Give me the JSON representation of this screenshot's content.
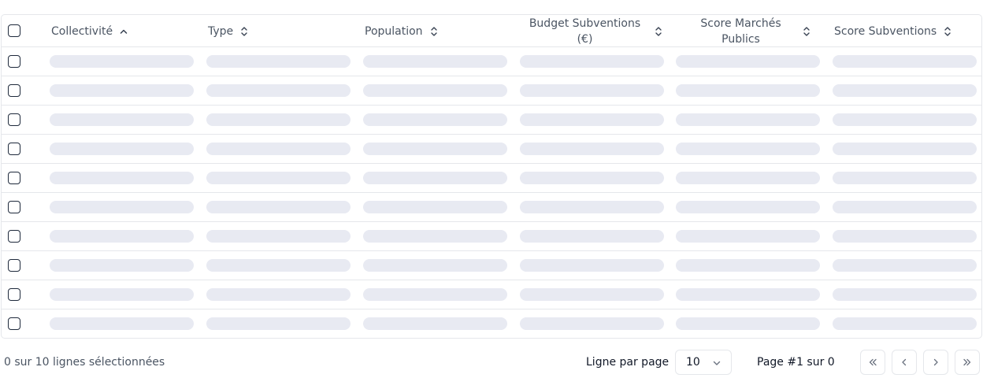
{
  "table": {
    "columns": [
      {
        "label": "Collectivité",
        "sort": "asc"
      },
      {
        "label": "Type",
        "sort": "none"
      },
      {
        "label": "Population",
        "sort": "none"
      },
      {
        "label": "Budget Subventions (€)",
        "sort": "none"
      },
      {
        "label": "Score Marchés Publics",
        "sort": "none"
      },
      {
        "label": "Score Subventions",
        "sort": "none"
      }
    ],
    "row_count": 10,
    "rows_state": "loading"
  },
  "footer": {
    "selection_text": "0 sur 10 lignes sélectionnées",
    "rows_per_page_label": "Ligne par page",
    "rows_per_page_value": "10",
    "page_info": "Page #1 sur 0"
  },
  "colors": {
    "border": "#e5e7eb",
    "skeleton": "#e8eaf2",
    "header_text": "#4b5563",
    "checkbox_border": "#1e293b"
  }
}
